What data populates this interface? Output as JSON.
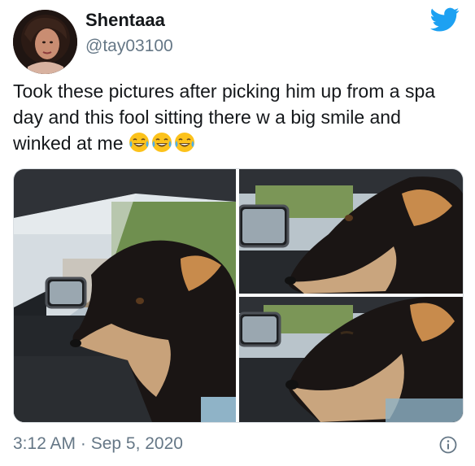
{
  "tweet": {
    "author_name": "Shentaaa",
    "author_handle": "@tay03100",
    "text": "Took these pictures after picking him up from a spa day and this fool sitting there w a big smile and winked at me",
    "emojis": [
      "face-with-tears-of-joy",
      "face-with-tears-of-joy",
      "face-with-tears-of-joy"
    ],
    "timestamp": "3:12 AM · Sep 5, 2020",
    "media_count": 3
  },
  "icons": {
    "brand": "twitter-bird-icon",
    "info": "info-icon"
  },
  "colors": {
    "twitter_blue": "#1da1f2",
    "secondary_text": "#657786",
    "primary_text": "#14171a"
  }
}
